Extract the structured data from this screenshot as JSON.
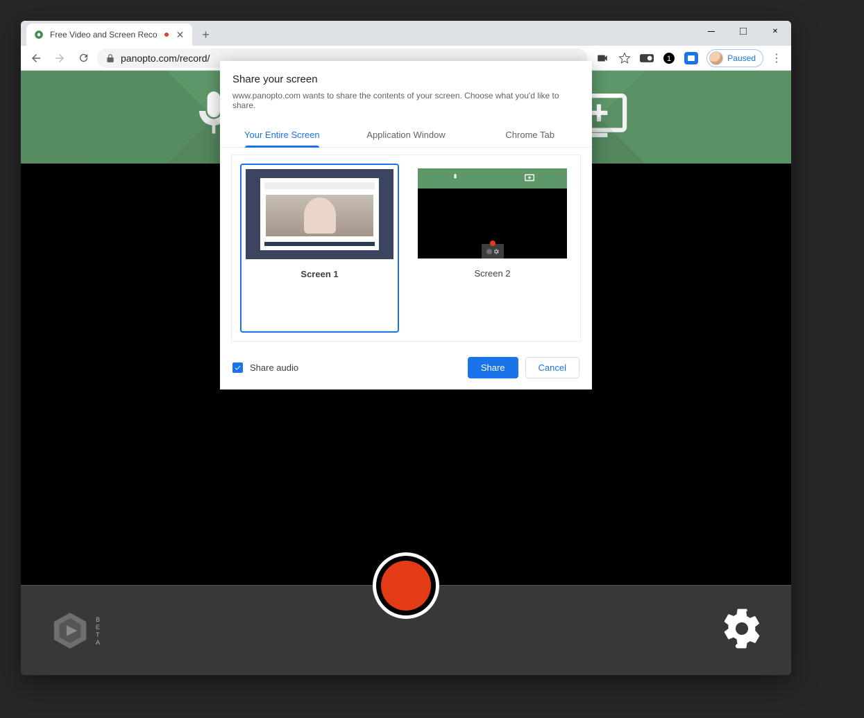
{
  "window": {
    "tab_title": "Free Video and Screen Reco",
    "url": "panopto.com/record/",
    "profile_label": "Paused"
  },
  "dialog": {
    "title": "Share your screen",
    "subtitle": "www.panopto.com wants to share the contents of your screen. Choose what you'd like to share.",
    "tabs": {
      "entire": "Your Entire Screen",
      "app": "Application Window",
      "chrome": "Chrome Tab"
    },
    "screens": {
      "s1": "Screen 1",
      "s2": "Screen 2"
    },
    "share_audio_label": "Share audio",
    "share_btn": "Share",
    "cancel_btn": "Cancel"
  },
  "bottom": {
    "beta": "BETA"
  }
}
